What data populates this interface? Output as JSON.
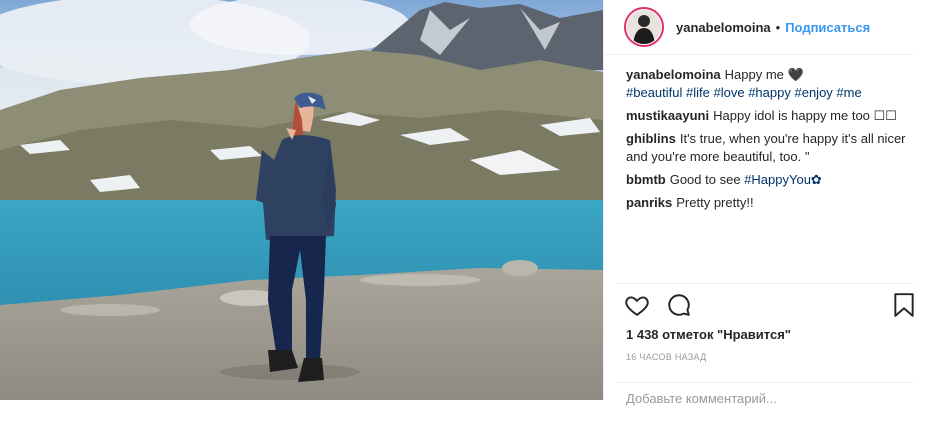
{
  "post": {
    "username": "yanabelomoina",
    "follow_label": "Подписаться",
    "separator": "•"
  },
  "caption": {
    "user": "yanabelomoina",
    "text": "Happy me 🖤",
    "hashtags": [
      "#beautiful",
      "#life",
      "#love",
      "#happy",
      "#enjoy",
      "#me"
    ]
  },
  "comments": [
    {
      "user": "mustikaayuni",
      "text": "Happy idol is happy me too ☐☐"
    },
    {
      "user": "ghiblins",
      "text": "It's true, when you're happy it's all nicer and you're more beautiful, too. \""
    },
    {
      "user": "bbmtb",
      "text": "Good to see",
      "tag": "#HappyYou✿"
    },
    {
      "user": "panriks",
      "text": "Pretty pretty!!"
    }
  ],
  "likes_text": "1 438 отметок \"Нравится\"",
  "timestamp": "16 ЧАСОВ НАЗАД",
  "add_comment_placeholder": "Добавьте комментарий..."
}
